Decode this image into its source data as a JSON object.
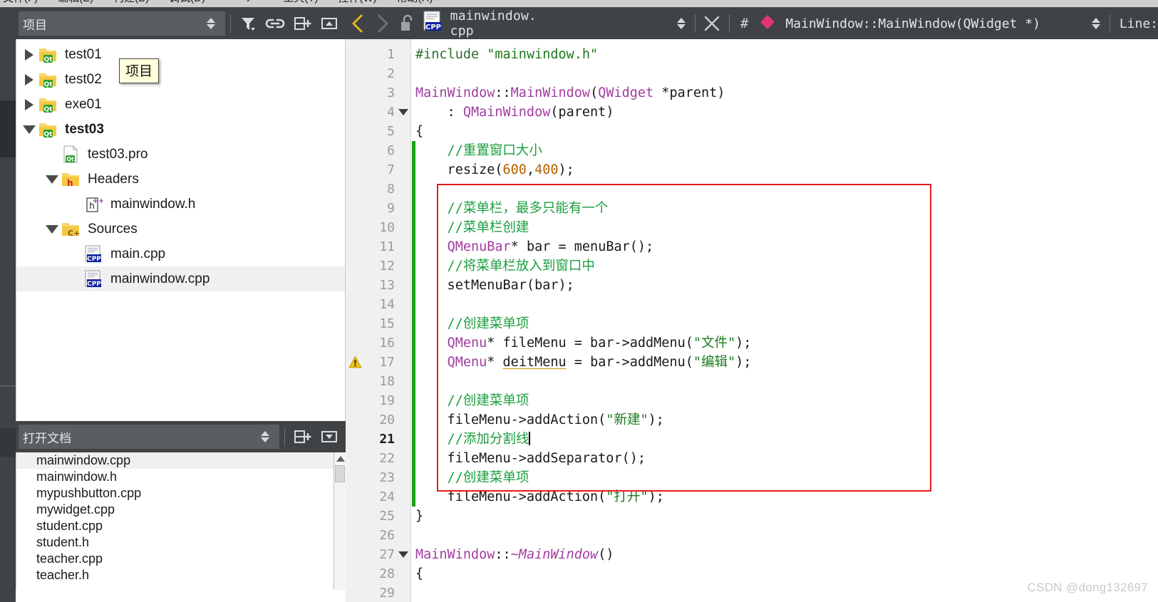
{
  "menubar": {
    "items": [
      "文件(F)",
      "编辑(E)",
      "构建(B)",
      "调试(D)",
      "Analyze",
      "工具(T)",
      "控件(W)",
      "帮助(H)"
    ]
  },
  "sidebar_strip": {
    "name": "mode-selector-strip"
  },
  "projects_panel": {
    "title": "项目",
    "toolbar": {
      "filter": "filter-icon",
      "link": "link-with-editor-icon",
      "split": "add-split-icon",
      "close": "close-panel-icon"
    },
    "tree": [
      {
        "label": "test01",
        "indent": 0,
        "expanded": false,
        "icon": "qt-project-folder",
        "bold": false,
        "selected": false
      },
      {
        "label": "test02",
        "indent": 0,
        "expanded": false,
        "icon": "qt-project-folder",
        "bold": false,
        "selected": false
      },
      {
        "label": "exe01",
        "indent": 0,
        "expanded": false,
        "icon": "qt-project-folder",
        "bold": false,
        "selected": false
      },
      {
        "label": "test03",
        "indent": 0,
        "expanded": true,
        "icon": "qt-project-folder",
        "bold": true,
        "selected": false
      },
      {
        "label": "test03.pro",
        "indent": 1,
        "expanded": null,
        "icon": "qt-pro-file",
        "bold": false,
        "selected": false
      },
      {
        "label": "Headers",
        "indent": 1,
        "expanded": true,
        "icon": "headers-folder",
        "bold": false,
        "selected": false
      },
      {
        "label": "mainwindow.h",
        "indent": 2,
        "expanded": null,
        "icon": "h-file",
        "bold": false,
        "selected": false
      },
      {
        "label": "Sources",
        "indent": 1,
        "expanded": true,
        "icon": "sources-folder",
        "bold": false,
        "selected": false
      },
      {
        "label": "main.cpp",
        "indent": 2,
        "expanded": null,
        "icon": "cpp-file",
        "bold": false,
        "selected": false
      },
      {
        "label": "mainwindow.cpp",
        "indent": 2,
        "expanded": null,
        "icon": "cpp-file",
        "bold": false,
        "selected": true
      }
    ]
  },
  "open_documents": {
    "title": "打开文档",
    "toolbar": {
      "split": "add-split-icon",
      "close": "close-panel-icon"
    },
    "items": [
      {
        "label": "mainwindow.cpp",
        "selected": true
      },
      {
        "label": "mainwindow.h",
        "selected": false
      },
      {
        "label": "mypushbutton.cpp",
        "selected": false
      },
      {
        "label": "mywidget.cpp",
        "selected": false
      },
      {
        "label": "student.cpp",
        "selected": false
      },
      {
        "label": "student.h",
        "selected": false
      },
      {
        "label": "teacher.cpp",
        "selected": false
      },
      {
        "label": "teacher.h",
        "selected": false
      }
    ]
  },
  "editor_toolbar": {
    "back": "‹",
    "forward": "›",
    "lock": "unlocked-padlock-icon",
    "file_icon": "cpp-file-icon",
    "file_name": "mainwindow. cpp",
    "close": "close-document-icon",
    "hash": "#",
    "symbol_icon": "method-diamond-icon",
    "symbol_name": "MainWindow::MainWindow(QWidget *)",
    "line_label": "Line:"
  },
  "tooltip": {
    "text": "项目"
  },
  "watermark": {
    "text": "CSDN @dong132697"
  },
  "editor": {
    "highlight_box": true,
    "current_line": 21,
    "warning_line": 17,
    "lines": [
      {
        "n": 1,
        "fold": false,
        "warn": false,
        "changed": false,
        "tokens": [
          {
            "t": "#include ",
            "c": "tok-pre"
          },
          {
            "t": "\"mainwindow.h\"",
            "c": "tok-str"
          }
        ]
      },
      {
        "n": 2,
        "fold": false,
        "warn": false,
        "changed": false,
        "tokens": []
      },
      {
        "n": 3,
        "fold": false,
        "warn": false,
        "changed": false,
        "tokens": [
          {
            "t": "MainWindow",
            "c": "tok-type"
          },
          {
            "t": "::",
            "c": "tok-plain"
          },
          {
            "t": "MainWindow",
            "c": "tok-type"
          },
          {
            "t": "(",
            "c": "tok-plain"
          },
          {
            "t": "QWidget",
            "c": "tok-type"
          },
          {
            "t": " *parent)",
            "c": "tok-plain"
          }
        ]
      },
      {
        "n": 4,
        "fold": true,
        "warn": false,
        "changed": false,
        "tokens": [
          {
            "t": "    : ",
            "c": "tok-plain"
          },
          {
            "t": "QMainWindow",
            "c": "tok-type"
          },
          {
            "t": "(parent)",
            "c": "tok-plain"
          }
        ]
      },
      {
        "n": 5,
        "fold": false,
        "warn": false,
        "changed": false,
        "tokens": [
          {
            "t": "{",
            "c": "tok-plain"
          }
        ]
      },
      {
        "n": 6,
        "fold": false,
        "warn": false,
        "changed": true,
        "tokens": [
          {
            "t": "    //重置窗口大小",
            "c": "tok-cmt"
          }
        ]
      },
      {
        "n": 7,
        "fold": false,
        "warn": false,
        "changed": true,
        "tokens": [
          {
            "t": "    resize(",
            "c": "tok-plain"
          },
          {
            "t": "600",
            "c": "tok-num"
          },
          {
            "t": ",",
            "c": "tok-plain"
          },
          {
            "t": "400",
            "c": "tok-num"
          },
          {
            "t": ");",
            "c": "tok-plain"
          }
        ]
      },
      {
        "n": 8,
        "fold": false,
        "warn": false,
        "changed": true,
        "tokens": []
      },
      {
        "n": 9,
        "fold": false,
        "warn": false,
        "changed": true,
        "tokens": [
          {
            "t": "    //菜单栏，最多只能有一个",
            "c": "tok-cmt"
          }
        ]
      },
      {
        "n": 10,
        "fold": false,
        "warn": false,
        "changed": true,
        "tokens": [
          {
            "t": "    //菜单栏创建",
            "c": "tok-cmt"
          }
        ]
      },
      {
        "n": 11,
        "fold": false,
        "warn": false,
        "changed": true,
        "tokens": [
          {
            "t": "    ",
            "c": "tok-plain"
          },
          {
            "t": "QMenuBar",
            "c": "tok-type"
          },
          {
            "t": "* bar = menuBar();",
            "c": "tok-plain"
          }
        ]
      },
      {
        "n": 12,
        "fold": false,
        "warn": false,
        "changed": true,
        "tokens": [
          {
            "t": "    //将菜单栏放入到窗口中",
            "c": "tok-cmt"
          }
        ]
      },
      {
        "n": 13,
        "fold": false,
        "warn": false,
        "changed": true,
        "tokens": [
          {
            "t": "    setMenuBar(bar);",
            "c": "tok-plain"
          }
        ]
      },
      {
        "n": 14,
        "fold": false,
        "warn": false,
        "changed": true,
        "tokens": []
      },
      {
        "n": 15,
        "fold": false,
        "warn": false,
        "changed": true,
        "tokens": [
          {
            "t": "    //创建菜单项",
            "c": "tok-cmt"
          }
        ]
      },
      {
        "n": 16,
        "fold": false,
        "warn": false,
        "changed": true,
        "tokens": [
          {
            "t": "    ",
            "c": "tok-plain"
          },
          {
            "t": "QMenu",
            "c": "tok-type"
          },
          {
            "t": "* fileMenu = bar->addMenu(",
            "c": "tok-plain"
          },
          {
            "t": "\"文件\"",
            "c": "tok-str"
          },
          {
            "t": ");",
            "c": "tok-plain"
          }
        ]
      },
      {
        "n": 17,
        "fold": false,
        "warn": true,
        "changed": true,
        "tokens": [
          {
            "t": "    ",
            "c": "tok-plain"
          },
          {
            "t": "QMenu",
            "c": "tok-type"
          },
          {
            "t": "* ",
            "c": "tok-plain"
          },
          {
            "t": "deitMenu",
            "c": "tok-err"
          },
          {
            "t": " = bar->addMenu(",
            "c": "tok-plain"
          },
          {
            "t": "\"编辑\"",
            "c": "tok-str"
          },
          {
            "t": ");",
            "c": "tok-plain"
          }
        ]
      },
      {
        "n": 18,
        "fold": false,
        "warn": false,
        "changed": true,
        "tokens": []
      },
      {
        "n": 19,
        "fold": false,
        "warn": false,
        "changed": true,
        "tokens": [
          {
            "t": "    //创建菜单项",
            "c": "tok-cmt"
          }
        ]
      },
      {
        "n": 20,
        "fold": false,
        "warn": false,
        "changed": true,
        "tokens": [
          {
            "t": "    fileMenu->addAction(",
            "c": "tok-plain"
          },
          {
            "t": "\"新建\"",
            "c": "tok-str"
          },
          {
            "t": ");",
            "c": "tok-plain"
          }
        ]
      },
      {
        "n": 21,
        "fold": false,
        "warn": false,
        "changed": true,
        "caret": true,
        "tokens": [
          {
            "t": "    //添加分割线",
            "c": "tok-cmt"
          }
        ]
      },
      {
        "n": 22,
        "fold": false,
        "warn": false,
        "changed": true,
        "tokens": [
          {
            "t": "    fileMenu->addSeparator();",
            "c": "tok-plain"
          }
        ]
      },
      {
        "n": 23,
        "fold": false,
        "warn": false,
        "changed": true,
        "tokens": [
          {
            "t": "    //创建菜单项",
            "c": "tok-cmt"
          }
        ]
      },
      {
        "n": 24,
        "fold": false,
        "warn": false,
        "changed": true,
        "tokens": [
          {
            "t": "    fileMenu->addAction(",
            "c": "tok-plain"
          },
          {
            "t": "\"打开\"",
            "c": "tok-str"
          },
          {
            "t": ");",
            "c": "tok-plain"
          }
        ]
      },
      {
        "n": 25,
        "fold": false,
        "warn": false,
        "changed": false,
        "tokens": [
          {
            "t": "}",
            "c": "tok-plain"
          }
        ]
      },
      {
        "n": 26,
        "fold": false,
        "warn": false,
        "changed": false,
        "tokens": []
      },
      {
        "n": 27,
        "fold": true,
        "warn": false,
        "changed": false,
        "tokens": [
          {
            "t": "MainWindow",
            "c": "tok-type"
          },
          {
            "t": "::",
            "c": "tok-plain"
          },
          {
            "t": "~MainWindow",
            "c": "tok-italic"
          },
          {
            "t": "()",
            "c": "tok-plain"
          }
        ]
      },
      {
        "n": 28,
        "fold": false,
        "warn": false,
        "changed": false,
        "tokens": [
          {
            "t": "{",
            "c": "tok-plain"
          }
        ]
      },
      {
        "n": 29,
        "fold": false,
        "warn": false,
        "changed": false,
        "tokens": []
      }
    ]
  },
  "colors": {
    "panel_dark": "#3f4346",
    "combo_fill": "#5a5e60",
    "selection": "#f0f0f0",
    "red_box": "#e81b1b",
    "change_bar_green": "#19a119",
    "comment_green": "#1b9e3e",
    "type_purple": "#a23ca2",
    "string_green": "#1d7a1d",
    "symbol_diamond": "#e0356f",
    "back_arrow_yellow": "#e8b320"
  }
}
